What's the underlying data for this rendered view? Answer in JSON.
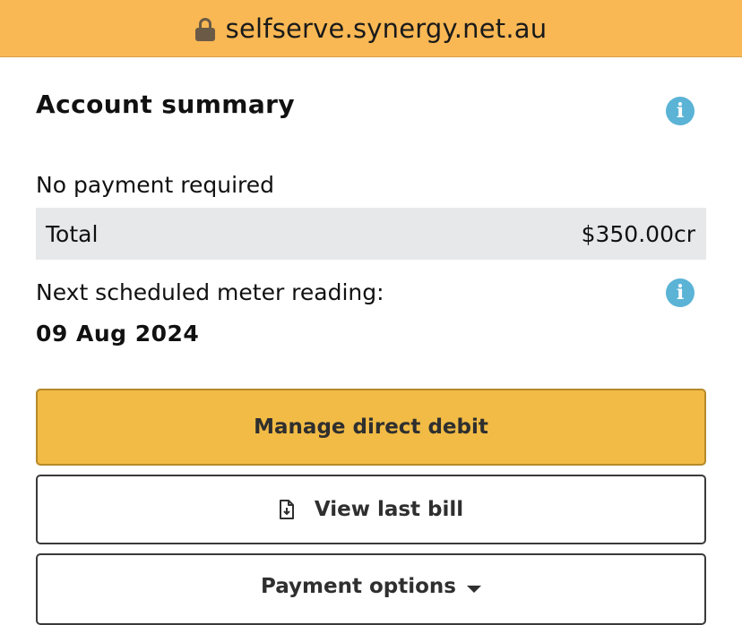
{
  "browser": {
    "url": "selfserve.synergy.net.au",
    "lock_icon": "lock-icon"
  },
  "account": {
    "title": "Account summary",
    "status": "No payment required",
    "total_label": "Total",
    "total_value": "$350.00cr",
    "meter_label": "Next scheduled meter reading:",
    "meter_date": "09 Aug 2024"
  },
  "buttons": {
    "direct_debit": "Manage direct debit",
    "view_bill": "View last bill",
    "payment_options": "Payment options"
  },
  "colors": {
    "url_bar": "#f9b854",
    "primary_button": "#f1bb45",
    "info_icon": "#5bb3d6",
    "total_row": "#e6e8ea"
  }
}
